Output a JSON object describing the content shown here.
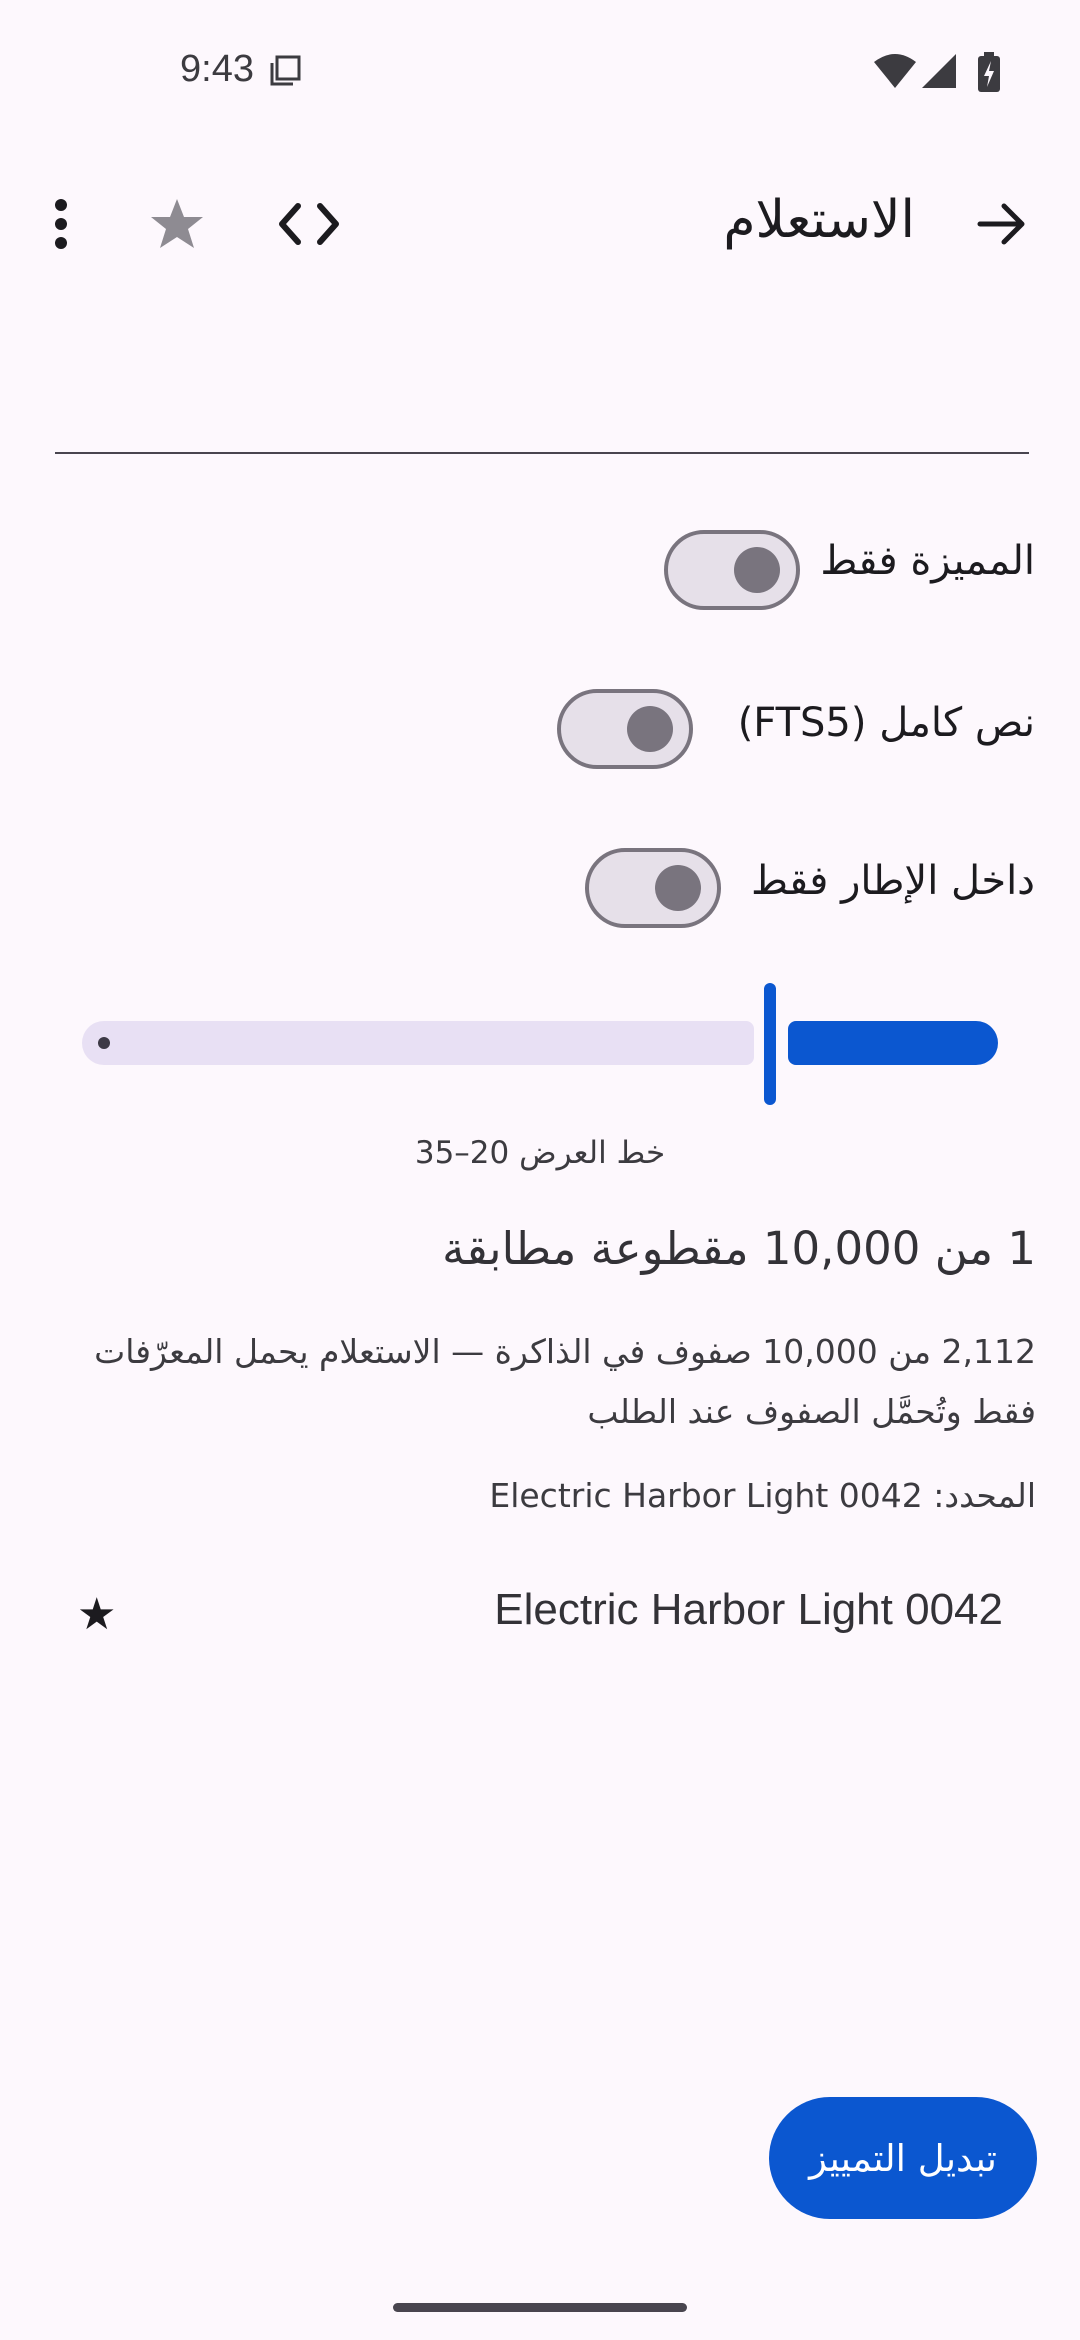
{
  "status_bar": {
    "time": "9:43"
  },
  "top_bar": {
    "title": "الاستعلام",
    "icons": [
      "back-arrow-icon",
      "code-icon",
      "star-icon",
      "more-vert-icon"
    ]
  },
  "search": {
    "value": "",
    "placeholder": ""
  },
  "filters": [
    {
      "label": "المميزة فقط",
      "checked": false
    },
    {
      "label": "نص كامل (FTS5)",
      "checked": false
    },
    {
      "label": "داخل الإطار فقط",
      "checked": false
    }
  ],
  "slider": {
    "caption": "خط العرض 20–35",
    "value_fraction": 0.75
  },
  "results": {
    "count_text": "1 من 10,000 مقطوعة مطابقة",
    "info_text": "2,112 من 10,000 صفوف في الذاكرة — الاستعلام يحمل المعرّفات فقط وتُحمَّل الصفوف عند الطلب",
    "selected_text": "المحدد: Electric Harbor Light 0042",
    "items": [
      {
        "title": "Electric Harbor Light 0042",
        "starred": true,
        "star_glyph": "★"
      }
    ]
  },
  "fab": {
    "label": "تبديل التمييز"
  },
  "colors": {
    "accent": "#0b57d0",
    "background": "#fdf8fd",
    "track_inactive": "#e8e0f4"
  }
}
